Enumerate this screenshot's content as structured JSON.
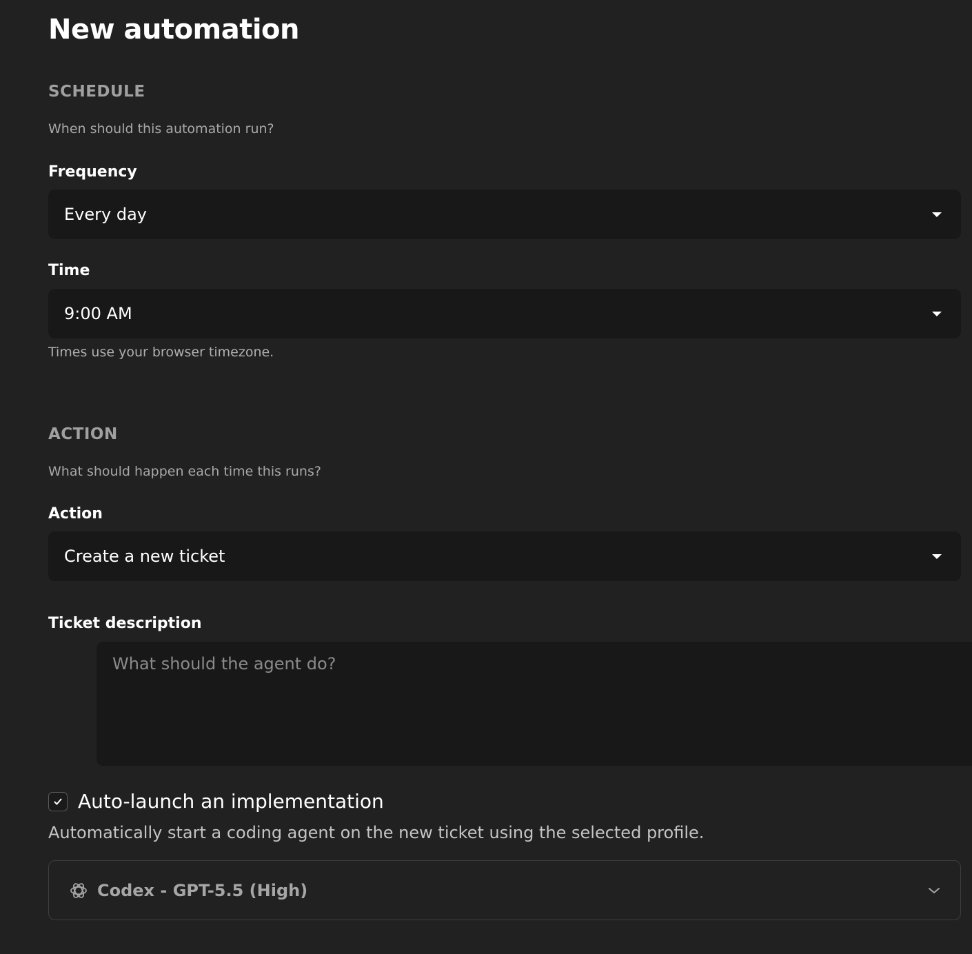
{
  "header": {
    "title": "New automation"
  },
  "schedule": {
    "heading": "SCHEDULE",
    "subheading": "When should this automation run?",
    "frequency": {
      "label": "Frequency",
      "value": "Every day"
    },
    "time": {
      "label": "Time",
      "value": "9:00 AM",
      "hint": "Times use your browser timezone."
    }
  },
  "action": {
    "heading": "ACTION",
    "subheading": "What should happen each time this runs?",
    "action_select": {
      "label": "Action",
      "value": "Create a new ticket"
    },
    "ticket_description": {
      "label": "Ticket description",
      "placeholder": "What should the agent do?",
      "value": ""
    },
    "auto_launch": {
      "label": "Auto-launch an implementation",
      "checked": true,
      "description": "Automatically start a coding agent on the new ticket using the selected profile."
    },
    "profile": {
      "value": "Codex - GPT-5.5 (High)",
      "icon": "openai-icon"
    }
  },
  "icons": {
    "dropdown": "caret-down-icon",
    "profile_dropdown": "chevron-down-icon",
    "check": "checkmark-icon",
    "resize": "resize-handle-icon"
  }
}
